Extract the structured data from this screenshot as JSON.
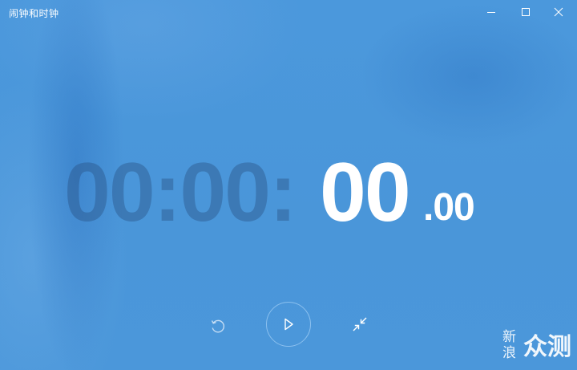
{
  "window": {
    "title": "闹钟和时钟"
  },
  "titlebar_buttons": {
    "minimize_icon": "minimize-icon",
    "maximize_icon": "maximize-icon",
    "close_icon": "close-icon"
  },
  "stopwatch": {
    "hours_minutes": "00:00:",
    "seconds": "00",
    "hundredths": ".00"
  },
  "controls": {
    "reset_icon": "reset-icon",
    "play_icon": "play-icon",
    "compact_icon": "compact-overlay-icon"
  },
  "watermark": {
    "small_text": "新浪",
    "big_text": "众测"
  },
  "colors": {
    "background": "#4a96d8",
    "dim_digits": "#2e5f95",
    "bright_digits": "#ffffff"
  }
}
